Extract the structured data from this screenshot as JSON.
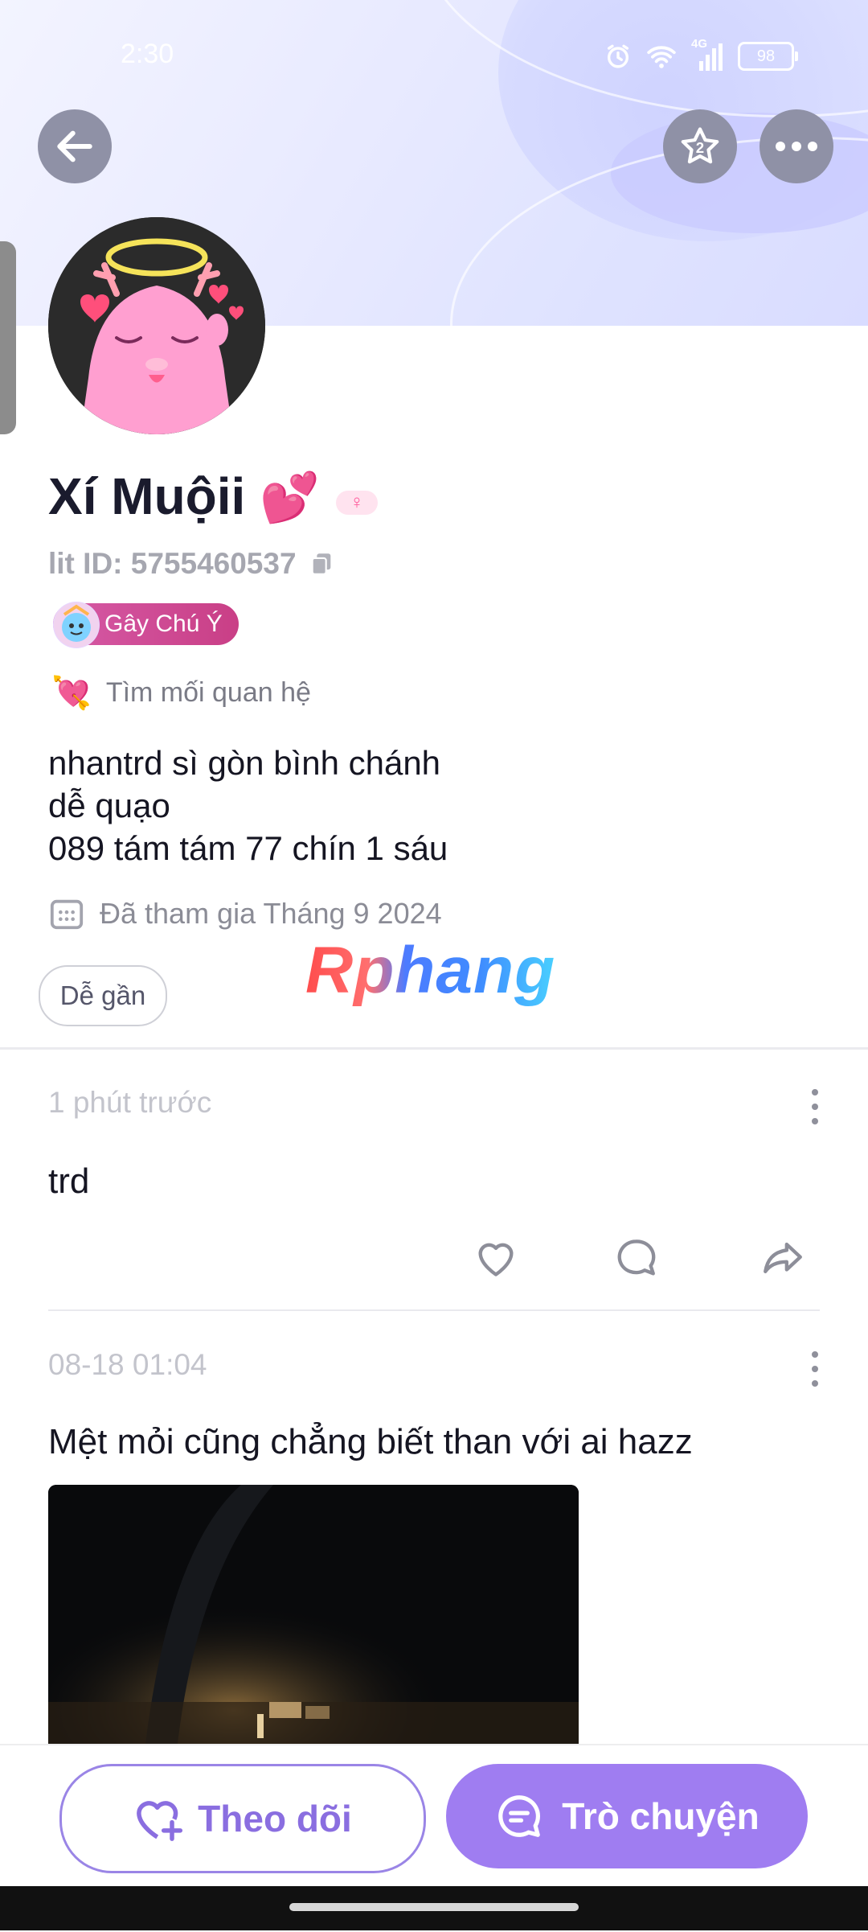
{
  "status_bar": {
    "time": "2:30",
    "network": "4G",
    "battery": "98"
  },
  "header": {
    "back_icon": "arrow-left-icon",
    "star_icon": "star-icon",
    "more_icon": "more-horizontal-icon"
  },
  "profile": {
    "name": "Xí Muộii",
    "name_emoji": "💕",
    "gender_icon": "female-icon",
    "lit_id_label": "lit ID: 5755460537",
    "level_badge": "Gây Chú Ý",
    "relationship_emoji": "💘",
    "relationship": "Tìm mối quan hệ",
    "bio_lines": [
      "nhantrd sì gòn bình chánh",
      "dễ quạo",
      "089 tám tám 77 chín 1 sáu"
    ],
    "joined": "Đã tham gia Tháng 9 2024",
    "tags": [
      "Dễ gần"
    ]
  },
  "watermark": "Rphang",
  "posts": [
    {
      "time": "1 phút trước",
      "text": "trd"
    },
    {
      "time": "08-18 01:04",
      "text": "Mệt mỏi cũng chẳng biết than với ai hazz"
    }
  ],
  "bottom": {
    "follow_label": "Theo dõi",
    "chat_label": "Trò chuyện"
  },
  "colors": {
    "accent": "#9f7df1",
    "outline": "#9a85e6",
    "text_dark": "#151522"
  }
}
